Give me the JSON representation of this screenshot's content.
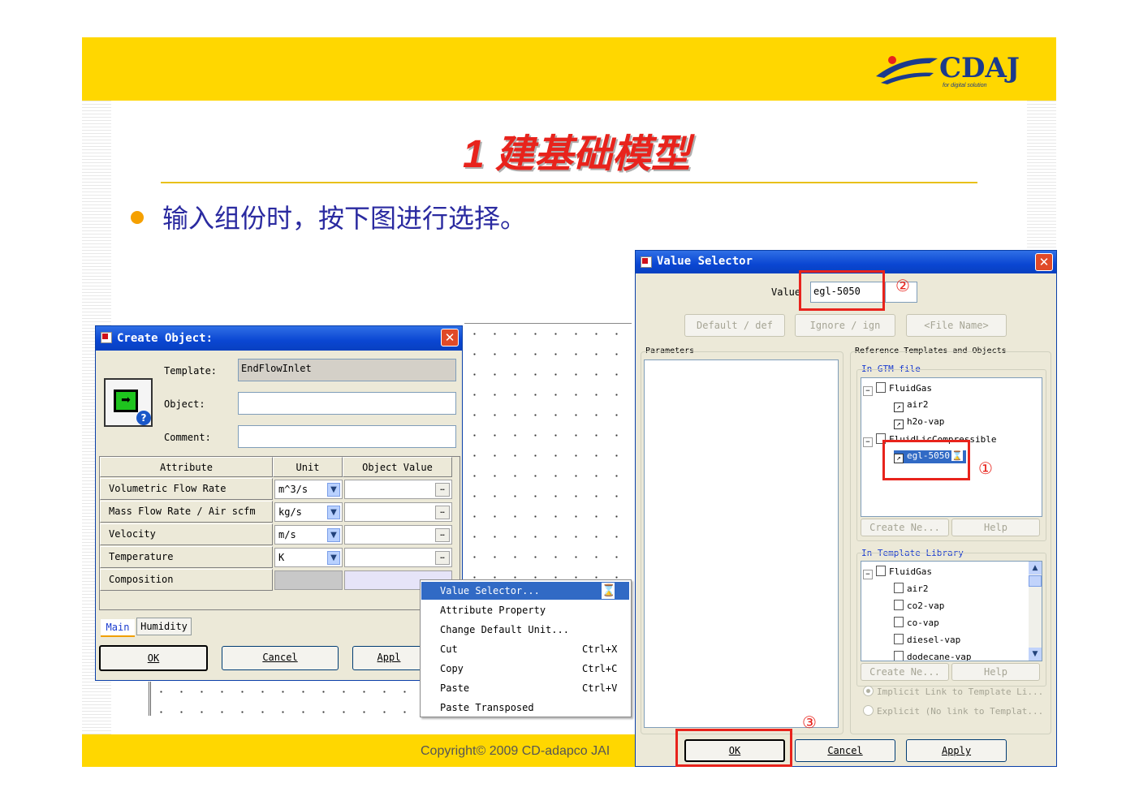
{
  "slide": {
    "logo_text": "CDAJ",
    "logo_tagline": "for digital solution",
    "title": "1 建基础模型",
    "bullet": "输入组份时，按下图进行选择。",
    "copyright": "Copyright© 2009 CD-adapco JAI",
    "colors": {
      "band": "#ffd700",
      "title": "#e8231c",
      "bullet_text": "#2a2aa0",
      "bullet_dot": "#f5a000"
    }
  },
  "create_object": {
    "title": "Create Object:",
    "template_label": "Template:",
    "template_value": "EndFlowInlet",
    "object_label": "Object:",
    "object_value": "",
    "comment_label": "Comment:",
    "comment_value": "",
    "columns": [
      "Attribute",
      "Unit",
      "Object Value"
    ],
    "rows": [
      {
        "attribute": "Volumetric Flow Rate",
        "unit": "m^3/s"
      },
      {
        "attribute": "Mass Flow Rate / Air scfm",
        "unit": "kg/s"
      },
      {
        "attribute": "Velocity",
        "unit": "m/s"
      },
      {
        "attribute": "Temperature",
        "unit": "K"
      },
      {
        "attribute": "Composition",
        "unit": ""
      }
    ],
    "tabs": [
      "Main",
      "Humidity"
    ],
    "buttons": {
      "ok": "OK",
      "cancel": "Cancel",
      "apply": "Appl"
    }
  },
  "context_menu": {
    "items": [
      {
        "label": "Value Selector...",
        "shortcut": ""
      },
      {
        "label": "Attribute Property",
        "shortcut": ""
      },
      {
        "label": "Change Default Unit...",
        "shortcut": ""
      },
      {
        "label": "Cut",
        "shortcut": "Ctrl+X"
      },
      {
        "label": "Copy",
        "shortcut": "Ctrl+C"
      },
      {
        "label": "Paste",
        "shortcut": "Ctrl+V"
      },
      {
        "label": "Paste Transposed",
        "shortcut": ""
      }
    ]
  },
  "value_selector": {
    "title": "Value Selector",
    "value_label": "Value",
    "value": "egl-5050",
    "buttons_top": [
      "Default / def",
      "Ignore / ign",
      "<File Name>"
    ],
    "parameters_label": "Parameters",
    "ref_label": "Reference Templates and Objects",
    "gtm_group": "In GTM file",
    "gtm_tree": [
      {
        "label": "FluidGas",
        "level": 0
      },
      {
        "label": "air2",
        "level": 1
      },
      {
        "label": "h2o-vap",
        "level": 1
      },
      {
        "label": "FluidLicCompressible",
        "level": 0
      },
      {
        "label": "egl-5050",
        "level": 1
      }
    ],
    "gtm_buttons": [
      "Create Ne...",
      "Help"
    ],
    "lib_group": "In Template Library",
    "lib_tree": [
      {
        "label": "FluidGas",
        "level": 0
      },
      {
        "label": "air2",
        "level": 1
      },
      {
        "label": "co2-vap",
        "level": 1
      },
      {
        "label": "co-vap",
        "level": 1
      },
      {
        "label": "diesel-vap",
        "level": 1
      },
      {
        "label": "dodecane-vap",
        "level": 1
      }
    ],
    "lib_buttons": [
      "Create Ne...",
      "Help"
    ],
    "radio": [
      "Implicit Link to Template Li...",
      "Explicit (No link to Templat..."
    ],
    "buttons_bottom": {
      "ok": "OK",
      "cancel": "Cancel",
      "apply": "Apply"
    }
  },
  "callouts": [
    "①",
    "②",
    "③"
  ]
}
